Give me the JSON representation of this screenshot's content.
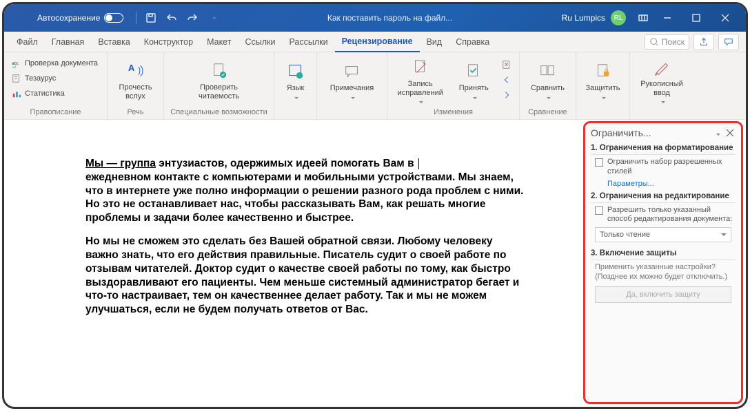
{
  "titlebar": {
    "autosave": "Автосохранение",
    "doc_title": "Как поставить пароль на файл...",
    "username": "Ru Lumpics",
    "avatar": "RL"
  },
  "tabs": {
    "items": [
      "Файл",
      "Главная",
      "Вставка",
      "Конструктор",
      "Макет",
      "Ссылки",
      "Рассылки",
      "Рецензирование",
      "Вид",
      "Справка"
    ],
    "active_index": 7,
    "search_placeholder": "Поиск"
  },
  "ribbon": {
    "groups": {
      "proofing": {
        "title": "Правописание",
        "check": "Проверка документа",
        "thesaurus": "Тезаурус",
        "stats": "Статистика"
      },
      "speech": {
        "title": "Речь",
        "read": "Прочесть\nвслух"
      },
      "accessibility": {
        "title": "Специальные возможности",
        "check": "Проверить\nчитаемость"
      },
      "language": {
        "lang": "Язык"
      },
      "comments": {
        "comments": "Примечания"
      },
      "tracking": {
        "title": "Изменения",
        "record": "Запись\nисправлений",
        "accept": "Принять"
      },
      "compare": {
        "title": "Сравнение",
        "compare": "Сравнить"
      },
      "protect": {
        "protect": "Защитить"
      },
      "ink": {
        "ink": "Рукописный\nввод"
      }
    }
  },
  "document": {
    "p1_lead": "Мы — группа",
    "p1_rest": " энтузиастов, одержимых идеей помогать Вам в ",
    "p1_cont": "ежедневном контакте с компьютерами и мобильными устройствами. Мы знаем, что в интернете уже полно информации о решении разного рода проблем с ними. Но это не останавливает нас, чтобы рассказывать Вам, как решать многие проблемы и задачи более качественно и быстрее.",
    "p2": "Но мы не сможем это сделать без Вашей обратной связи. Любому человеку важно знать, что его действия правильные. Писатель судит о своей работе по отзывам читателей. Доктор судит о качестве своей работы по тому, как быстро выздоравливают его пациенты. Чем меньше системный администратор бегает и что-то настраивает, тем он качественнее делает работу. Так и мы не можем улучшаться, если не будем получать ответов от Вас."
  },
  "pane": {
    "title": "Ограничить...",
    "s1_title": "1. Ограничения на форматирование",
    "s1_chk": "Ограничить набор разрешенных стилей",
    "s1_link": "Параметры...",
    "s2_title": "2. Ограничения на редактирование",
    "s2_chk": "Разрешить только указанный способ редактирования документа:",
    "s2_sel": "Только чтение",
    "s3_title": "3. Включение защиты",
    "s3_desc": "Применить указанные настройки? (Позднее их можно будет отключить.)",
    "s3_btn": "Да, включить защиту"
  }
}
